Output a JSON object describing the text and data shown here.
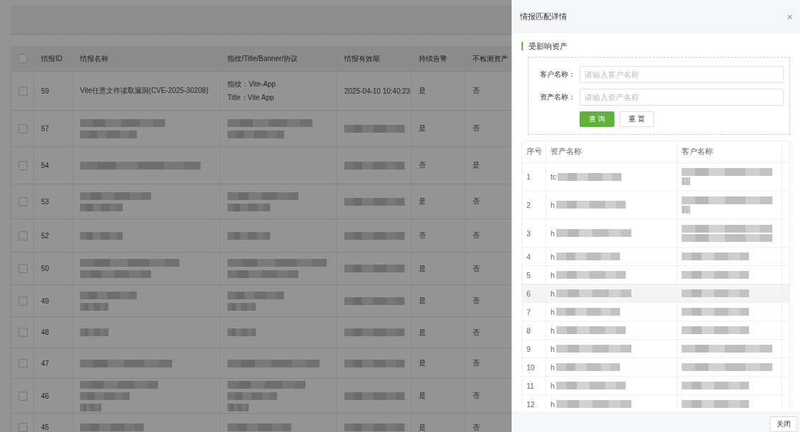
{
  "table": {
    "all_checked": false,
    "columns": [
      "情报ID",
      "情报名称",
      "指纹/Title/Banner/协议",
      "情报有效期",
      "持续告警",
      "不检测资产"
    ],
    "rows": [
      {
        "checked": false,
        "id": "59",
        "name": {
          "kind": "text",
          "lines": [
            "Vite任意文件读取漏洞(CVE-2025-30208)"
          ]
        },
        "fingerprint": {
          "kind": "text",
          "lines": [
            "指纹：Vite-App",
            "Title：Vite App"
          ]
        },
        "validity": {
          "kind": "text",
          "lines": [
            "2025-04-10 10:40:23"
          ]
        },
        "alert": "是",
        "skip": "否"
      },
      {
        "checked": false,
        "id": "57",
        "name": {
          "kind": "redacted"
        },
        "fingerprint": {
          "kind": "redacted"
        },
        "validity": {
          "kind": "redacted"
        },
        "alert": "是",
        "skip": "否"
      },
      {
        "checked": false,
        "id": "54",
        "name": {
          "kind": "redacted"
        },
        "fingerprint": {
          "kind": "empty"
        },
        "validity": {
          "kind": "redacted"
        },
        "alert": "否",
        "skip": "是"
      },
      {
        "checked": false,
        "id": "53",
        "name": {
          "kind": "redacted"
        },
        "fingerprint": {
          "kind": "redacted"
        },
        "validity": {
          "kind": "redacted"
        },
        "alert": "是",
        "skip": "否"
      },
      {
        "checked": false,
        "id": "52",
        "name": {
          "kind": "redacted"
        },
        "fingerprint": {
          "kind": "redacted"
        },
        "validity": {
          "kind": "redacted"
        },
        "alert": "否",
        "skip": "否"
      },
      {
        "checked": false,
        "id": "50",
        "name": {
          "kind": "redacted"
        },
        "fingerprint": {
          "kind": "redacted"
        },
        "validity": {
          "kind": "redacted"
        },
        "alert": "是",
        "skip": "否"
      },
      {
        "checked": false,
        "id": "49",
        "name": {
          "kind": "redacted"
        },
        "fingerprint": {
          "kind": "redacted"
        },
        "validity": {
          "kind": "redacted"
        },
        "alert": "是",
        "skip": "否"
      },
      {
        "checked": false,
        "id": "48",
        "name": {
          "kind": "redacted"
        },
        "fingerprint": {
          "kind": "redacted"
        },
        "validity": {
          "kind": "redacted"
        },
        "alert": "是",
        "skip": "否"
      },
      {
        "checked": false,
        "id": "47",
        "name": {
          "kind": "redacted"
        },
        "fingerprint": {
          "kind": "redacted"
        },
        "validity": {
          "kind": "redacted"
        },
        "alert": "是",
        "skip": "否"
      },
      {
        "checked": false,
        "id": "46",
        "name": {
          "kind": "redacted"
        },
        "fingerprint": {
          "kind": "redacted"
        },
        "validity": {
          "kind": "redacted"
        },
        "alert": "是",
        "skip": "否"
      },
      {
        "checked": false,
        "id": "45",
        "name": {
          "kind": "redacted"
        },
        "fingerprint": {
          "kind": "redacted"
        },
        "validity": {
          "kind": "redacted"
        },
        "alert": "是",
        "skip": "否"
      }
    ]
  },
  "drawer": {
    "title": "情报匹配详情",
    "close": "×",
    "section": "受影响资产",
    "fields": [
      {
        "label": "客户名称：",
        "placeholder": "请输入客户名称"
      },
      {
        "label": "资产名称：",
        "placeholder": "请输入资产名称"
      }
    ],
    "buttons": [
      {
        "kind": "primary",
        "label": "查 询"
      },
      {
        "kind": "default",
        "label": "重 置"
      }
    ],
    "columns": [
      "序号",
      "资产名称",
      "客户名称"
    ],
    "rows": [
      {
        "index": "1",
        "asset": "tc",
        "highlighted": false
      },
      {
        "index": "2",
        "asset": "h",
        "highlighted": false
      },
      {
        "index": "3",
        "asset": "h",
        "highlighted": false
      },
      {
        "index": "4",
        "asset": "h",
        "highlighted": false
      },
      {
        "index": "5",
        "asset": "h",
        "highlighted": false
      },
      {
        "index": "6",
        "asset": "h",
        "highlighted": true
      },
      {
        "index": "7",
        "asset": "h",
        "highlighted": false
      },
      {
        "index": "8",
        "asset": "h",
        "highlighted": false
      },
      {
        "index": "9",
        "asset": "h",
        "highlighted": false
      },
      {
        "index": "10",
        "asset": "h",
        "highlighted": false
      },
      {
        "index": "11",
        "asset": "h",
        "highlighted": false
      },
      {
        "index": "12",
        "asset": "h",
        "highlighted": false
      }
    ],
    "footer_button": "关闭"
  }
}
